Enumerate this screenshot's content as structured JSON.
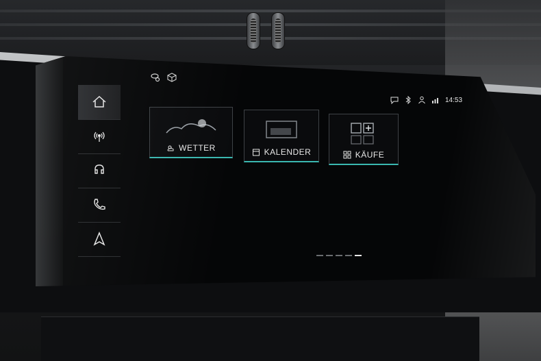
{
  "status": {
    "time": "14:53"
  },
  "sidebar": {
    "items": [
      {
        "id": "home",
        "icon": "home-icon"
      },
      {
        "id": "radio",
        "icon": "radio-icon"
      },
      {
        "id": "media",
        "icon": "music-icon"
      },
      {
        "id": "phone",
        "icon": "phone-icon"
      },
      {
        "id": "navigation",
        "icon": "navigation-icon"
      }
    ]
  },
  "tiles": [
    {
      "label": "WETTER",
      "icon": "weather-icon"
    },
    {
      "label": "KALENDER",
      "icon": "calendar-icon"
    },
    {
      "label": "KÄUFE",
      "icon": "store-icon"
    }
  ],
  "pager": {
    "count": 5,
    "active": 4
  },
  "colors": {
    "accent": "#3ab7b0",
    "text": "#e8e8e8"
  }
}
